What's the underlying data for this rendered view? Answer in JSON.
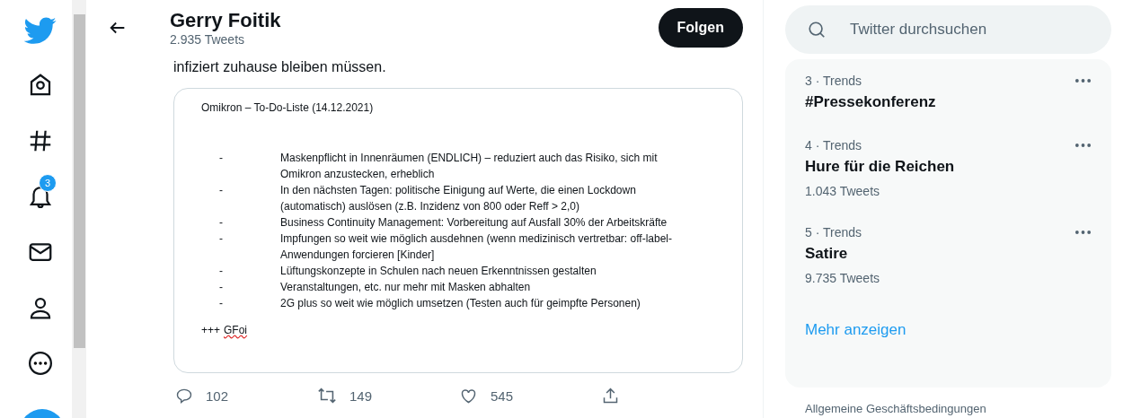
{
  "sidebar": {
    "notification_count": "3"
  },
  "header": {
    "name": "Gerry Foitik",
    "tweet_count": "2.935 Tweets",
    "follow_button": "Folgen"
  },
  "tweet": {
    "text": "infiziert zuhause bleiben müssen.",
    "document": {
      "title": "Omikron – To-Do-Liste (14.12.2021)",
      "items": [
        {
          "bullet": "-",
          "text": "Maskenpflicht in Innenräumen (ENDLICH) – reduziert auch das Risiko, sich mit Omikron anzustecken, erheblich"
        },
        {
          "bullet": "-",
          "text": "In den nächsten Tagen: politische Einigung auf Werte, die einen Lockdown (automatisch) auslösen (z.B. Inzidenz von 800 oder Reff > 2,0)"
        },
        {
          "bullet": "-",
          "text": "Business Continuity Management: Vorbereitung auf Ausfall 30% der Arbeitskräfte"
        },
        {
          "bullet": "-",
          "text": "Impfungen so weit wie möglich ausdehnen (wenn medizinisch vertretbar: off-label-Anwendungen forcieren [Kinder]"
        },
        {
          "bullet": "-",
          "text": "Lüftungskonzepte in Schulen nach neuen Erkenntnissen gestalten"
        },
        {
          "bullet": "-",
          "text": "Veranstaltungen, etc. nur mehr mit Masken abhalten"
        },
        {
          "bullet": "-",
          "text": "2G plus so weit wie möglich umsetzen (Testen auch für geimpfte Personen)"
        }
      ],
      "signature_prefix": "+++",
      "signature": "GFoi",
      "signature_misspelled": true
    },
    "actions": [
      {
        "kind": "reply",
        "count": "102"
      },
      {
        "kind": "retweet",
        "count": "149"
      },
      {
        "kind": "like",
        "count": "545"
      },
      {
        "kind": "share"
      }
    ]
  },
  "search": {
    "placeholder": "Twitter durchsuchen"
  },
  "trends": {
    "items": [
      {
        "meta": "3 · Trends",
        "title": "#Pressekonferenz"
      },
      {
        "meta": "4 · Trends",
        "title": "Hure für die Reichen",
        "tweet_count": "1.043 Tweets"
      },
      {
        "meta": "5 · Trends",
        "title": "Satire",
        "tweet_count": "9.735 Tweets"
      }
    ],
    "more_link": "Mehr anzeigen"
  },
  "footer_link": "Allgemeine Geschäftsbedingungen"
}
